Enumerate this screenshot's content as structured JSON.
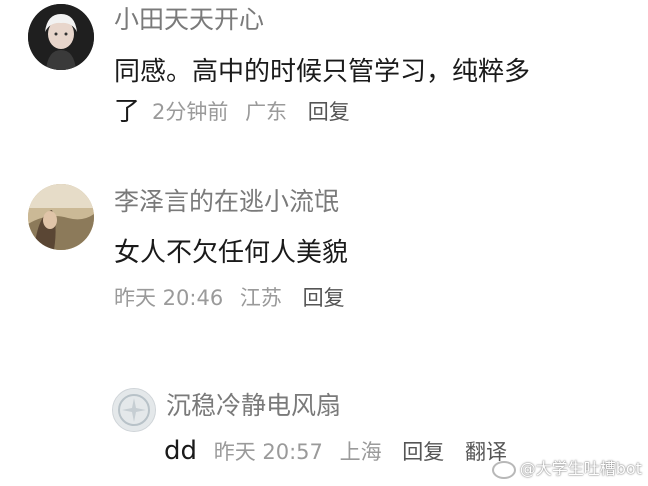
{
  "comments": [
    {
      "username": "小田天天开心",
      "content_line1": "同感。高中的时候只管学习，纯粹多",
      "content_line2": "了",
      "time": "2分钟前",
      "location": "广东",
      "reply_label": "回复"
    },
    {
      "username": "李泽言的在逃小流氓",
      "content": "女人不欠任何人美貌",
      "time": "昨天 20:46",
      "location": "江苏",
      "reply_label": "回复"
    },
    {
      "username": "沉稳冷静电风扇",
      "content": "dd",
      "time": "昨天 20:57",
      "location": "上海",
      "reply_label": "回复",
      "translate_label": "翻译"
    }
  ],
  "watermark": {
    "text": "@大学生吐槽bot"
  }
}
